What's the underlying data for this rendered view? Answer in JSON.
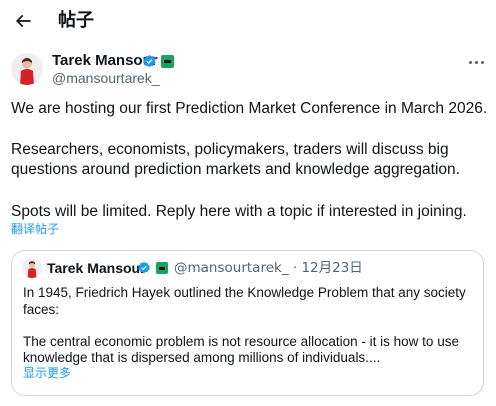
{
  "header": {
    "title": "帖子",
    "back_icon": "arrow-left-icon"
  },
  "post": {
    "author_name": "Tarek Mansour",
    "author_handle": "@mansourtarek_",
    "verified_color": "#1d9bf0",
    "affiliate_color": "#1aa260",
    "paragraphs": [
      "We are hosting our first Prediction Market Conference in March 2026.",
      "Researchers, economists, policymakers, traders will discuss big",
      "questions around prediction markets and knowledge aggregation.",
      "Spots will be limited. Reply here with a topic if interested in joining."
    ],
    "translate_label": "翻译帖子"
  },
  "quote": {
    "author_name": "Tarek Mansour",
    "meta": "@mansourtarek_ · 12月23日",
    "lines": [
      "In 1945, Friedrich Hayek outlined the Knowledge Problem that any society",
      "faces:",
      "The central economic problem is not resource allocation - it is how to use",
      "knowledge that is dispersed among millions of individuals...."
    ],
    "show_more_label": "显示更多"
  },
  "colors": {
    "link": "#1d9bf0",
    "secondary_text": "#536471",
    "border": "#cfd9de"
  }
}
